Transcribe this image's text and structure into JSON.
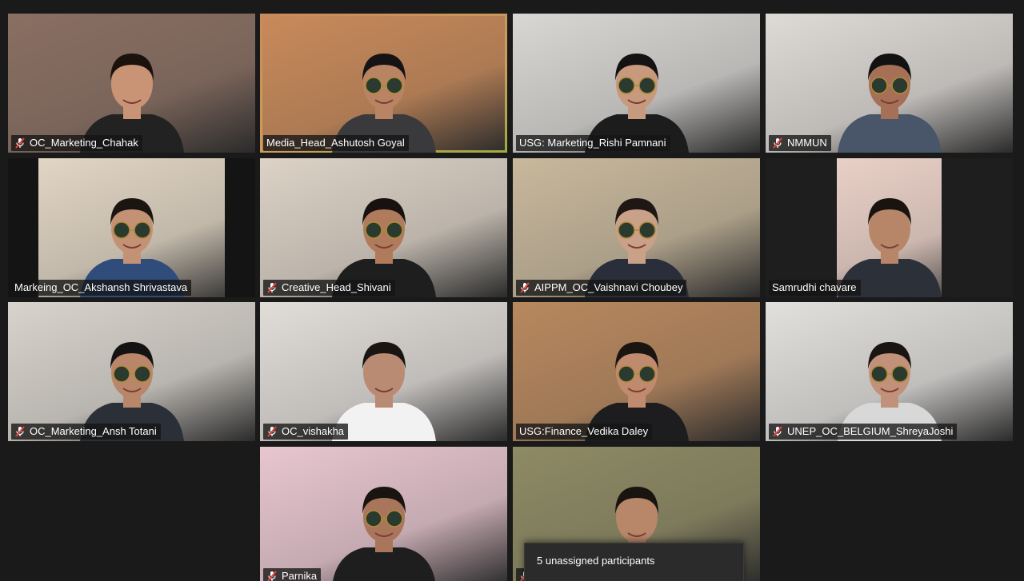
{
  "participants": [
    {
      "name": "OC_Marketing_Chahak",
      "muted": true,
      "bg": "#8a6f62",
      "suit": "#222222",
      "skin": "#c99476",
      "hair": "#1b120e",
      "glasses": false
    },
    {
      "name": "Media_Head_Ashutosh Goyal",
      "muted": false,
      "active": true,
      "bg": "#c98a5a",
      "suit": "#3a3a3c",
      "skin": "#b98463",
      "hair": "#151313",
      "glasses": true
    },
    {
      "name": "USG: Marketing_Rishi Pamnani",
      "muted": false,
      "bg": "#d9d7d4",
      "suit": "#1c1c1c",
      "skin": "#c89a7d",
      "hair": "#141212",
      "glasses": true
    },
    {
      "name": "NMMUN",
      "muted": true,
      "bg": "#dedad6",
      "suit": "#49566a",
      "skin": "#a57056",
      "hair": "#131212",
      "glasses": true
    },
    {
      "name": "Markeing_OC_Akshansh Shrivastava",
      "muted": false,
      "bg": "#e4d8c6",
      "suit": "#2f4c7a",
      "skin": "#c39275",
      "hair": "#1b1511",
      "glasses": true,
      "letterbox": true
    },
    {
      "name": "Creative_Head_Shivani",
      "muted": true,
      "bg": "#dcd2c6",
      "suit": "#1e1e1e",
      "skin": "#b07b5d",
      "hair": "#17120f",
      "glasses": true
    },
    {
      "name": "AIPPM_OC_Vaishnavi Choubey",
      "muted": true,
      "bg": "#c8b89c",
      "suit": "#2a2e3a",
      "skin": "#c9a088",
      "hair": "#1e1713",
      "glasses": true
    },
    {
      "name": "Samrudhi chavare",
      "muted": false,
      "bg": "#f0d6cc",
      "suit": "#2c3038",
      "skin": "#b78568",
      "hair": "#1a1411",
      "glasses": false,
      "narrow": true
    },
    {
      "name": "OC_Marketing_Ansh Totani",
      "muted": true,
      "bg": "#d8d3cc",
      "suit": "#2b2f38",
      "skin": "#b9866a",
      "hair": "#141212",
      "glasses": true
    },
    {
      "name": "OC_vishakha",
      "muted": true,
      "bg": "#e1ddd9",
      "suit": "#f2f2f2",
      "skin": "#b88b72",
      "hair": "#1a1512",
      "glasses": false
    },
    {
      "name": "USG:Finance_Vedika Daley",
      "muted": false,
      "bg": "#b8885e",
      "suit": "#1d1d1f",
      "skin": "#c08a6e",
      "hair": "#1b1511",
      "glasses": true
    },
    {
      "name": "UNEP_OC_BELGIUM_ShreyaJoshi",
      "muted": true,
      "bg": "#e2e0dd",
      "suit": "#d8d8d8",
      "skin": "#c2917a",
      "hair": "#1a1512",
      "glasses": true
    },
    {
      "name": "Parnika",
      "muted": true,
      "bg": "#e8c6cf",
      "suit": "#1e1e1e",
      "skin": "#a9765b",
      "hair": "#1a1411",
      "glasses": true
    },
    {
      "name": "",
      "muted": true,
      "bg": "#8e8a64",
      "suit": "#2a2a2a",
      "skin": "#b88669",
      "hair": "#1a1411",
      "glasses": false
    }
  ],
  "toast": {
    "text": "5 unassigned participants"
  },
  "colors": {
    "background": "#1a1a1a",
    "active_speaker_border": "#d9e85a",
    "muted_icon": "#e8423a",
    "name_tag_text": "#ffffff"
  }
}
